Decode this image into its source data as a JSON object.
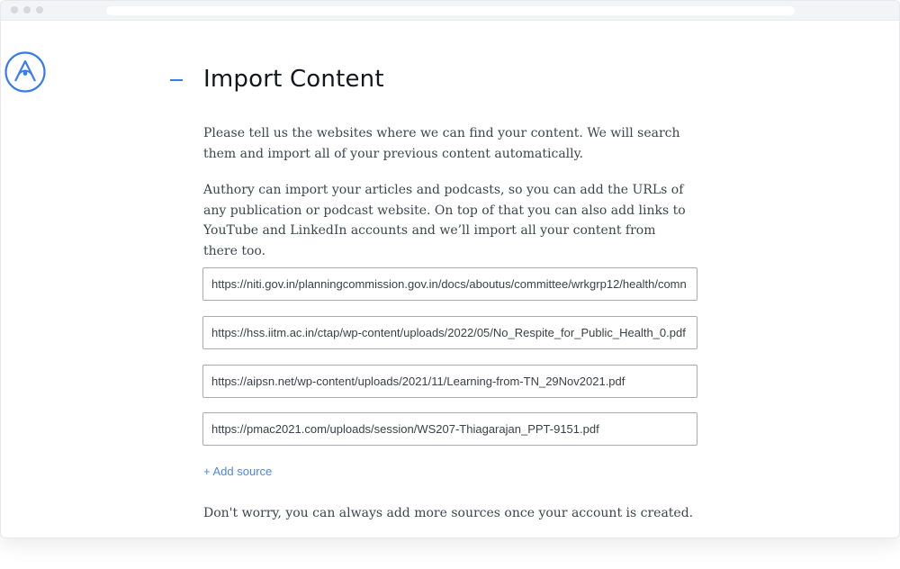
{
  "window": {
    "title_bar": ""
  },
  "brand": {
    "logo_icon": "authory-logo-icon",
    "accent_color": "#3b7bf0"
  },
  "page": {
    "title": "Import Content",
    "intro": "Please tell us the websites where we can find your content. We will search them and import all of your previous content automatically.",
    "details": "Authory can import your articles and podcasts, so you can add the URLs of any publication or podcast website. On top of that you can also add links to YouTube and LinkedIn accounts and we’ll import all your content from there too.",
    "sources": [
      {
        "value": "https://niti.gov.in/planningcommission.gov.in/docs/aboutus/committee/wrkgrp12/health/comn"
      },
      {
        "value": "https://hss.iitm.ac.in/ctap/wp-content/uploads/2022/05/No_Respite_for_Public_Health_0.pdf"
      },
      {
        "value": "https://aipsn.net/wp-content/uploads/2021/11/Learning-from-TN_29Nov2021.pdf"
      },
      {
        "value": "https://pmac2021.com/uploads/session/WS207-Thiagarajan_PPT-9151.pdf"
      }
    ],
    "add_source_label": "+ Add source",
    "note": "Don't worry, you can always add more sources once your account is created."
  }
}
